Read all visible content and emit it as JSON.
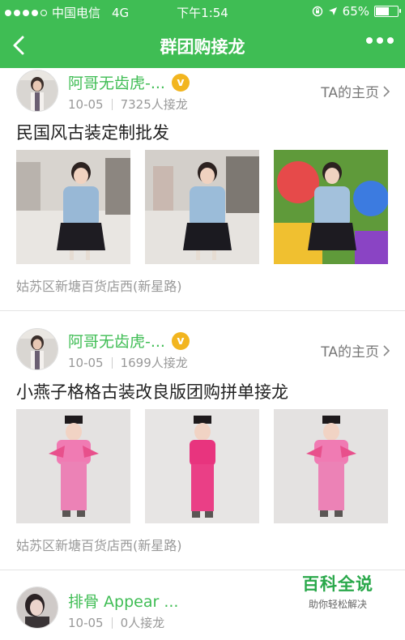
{
  "statusbar": {
    "carrier": "中国电信",
    "network": "4G",
    "time": "下午1:54",
    "battery": "65%",
    "battery_level": 0.65
  },
  "header": {
    "title": "群团购接龙"
  },
  "posts": [
    {
      "user": "阿哥无齿虎-...",
      "date": "10-05",
      "count": "7325人接龙",
      "home": "TA的主页",
      "title": "民国风古装定制批发",
      "address": "姑苏区新塘百货店西(新星路)"
    },
    {
      "user": "阿哥无齿虎-...",
      "date": "10-05",
      "count": "1699人接龙",
      "home": "TA的主页",
      "title": "小燕子格格古装改良版团购拼单接龙",
      "address": "姑苏区新塘百货店西(新星路)"
    },
    {
      "user": "排骨 Appear ...",
      "date": "10-05",
      "count": "0人接龙"
    }
  ],
  "watermark": {
    "title": "百科全说",
    "subtitle": "助你轻松解决"
  }
}
